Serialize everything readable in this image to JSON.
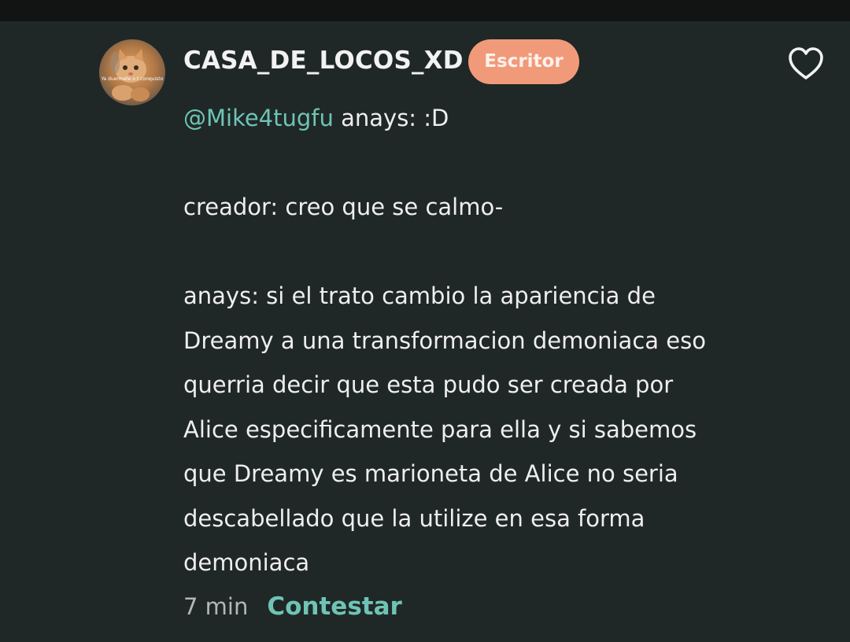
{
  "comment": {
    "author": "CASA_DE_LOCOS_XD",
    "badge": "Escritor",
    "avatar_caption": "Ya duermete o t conquisto",
    "mention": "@Mike4tugfu",
    "first_line_rest": " anays: :D",
    "body": "\n\ncreador: creo que se calmo-\n\nanays: si el trato cambio la apariencia de\nDreamy a una transformacion demoniaca eso\nquerria decir que esta pudo ser creada por\nAlice especificamente para ella y si sabemos\nque Dreamy es marioneta de Alice no seria\ndescabellado que la utilize en esa forma\ndemoniaca",
    "time": "7 min",
    "reply_label": "Contestar",
    "like_icon": "heart-outline-icon"
  },
  "colors": {
    "background": "#1f2826",
    "top_bar": "#111413",
    "badge": "#f19a79",
    "accent": "#6fc3b6",
    "text": "#eeeeee",
    "muted": "#b3b8b6"
  }
}
